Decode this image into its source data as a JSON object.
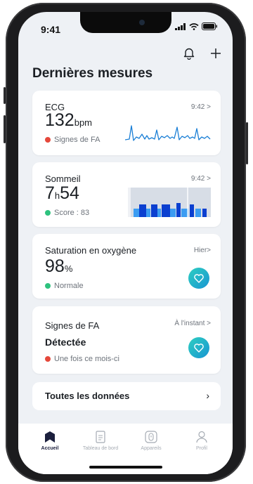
{
  "status_bar": {
    "time": "9:41"
  },
  "page": {
    "title": "Dernières mesures"
  },
  "cards": {
    "ecg": {
      "title": "ECG",
      "time": "9:42 >",
      "value": "132",
      "unit": "bpm",
      "status": "Signes de FA",
      "status_color": "#e5483b"
    },
    "sleep": {
      "title": "Sommeil",
      "time": "9:42 >",
      "value_h": "7",
      "value_h_unit": "h",
      "value_m": "54",
      "status": "Score : 83",
      "status_color": "#2ec27e"
    },
    "oxygen": {
      "title": "Saturation en oxygène",
      "time": "Hier>",
      "value": "98",
      "unit": "%",
      "status": "Normale",
      "status_color": "#2ec27e"
    },
    "afib": {
      "title": "Signes de FA",
      "time": "À l'instant >",
      "result": "Détectée",
      "status": "Une fois ce mois-ci",
      "status_color": "#e5483b"
    }
  },
  "all_data": {
    "label": "Toutes les données",
    "arrow": "›"
  },
  "tabs": [
    {
      "label": "Accueil",
      "icon": "home-icon",
      "active": true
    },
    {
      "label": "Tableau de bord",
      "icon": "dashboard-icon",
      "active": false
    },
    {
      "label": "Appareils",
      "icon": "device-icon",
      "active": false
    },
    {
      "label": "Profil",
      "icon": "profile-icon",
      "active": false
    }
  ],
  "colors": {
    "accent_gradient_start": "#2ecfc1",
    "accent_gradient_end": "#1894d2",
    "ecg_line": "#1a7fd6",
    "sleep_deep": "#0b3fd0",
    "sleep_light": "#3b9cf2",
    "sleep_awake": "#d7dde6"
  }
}
